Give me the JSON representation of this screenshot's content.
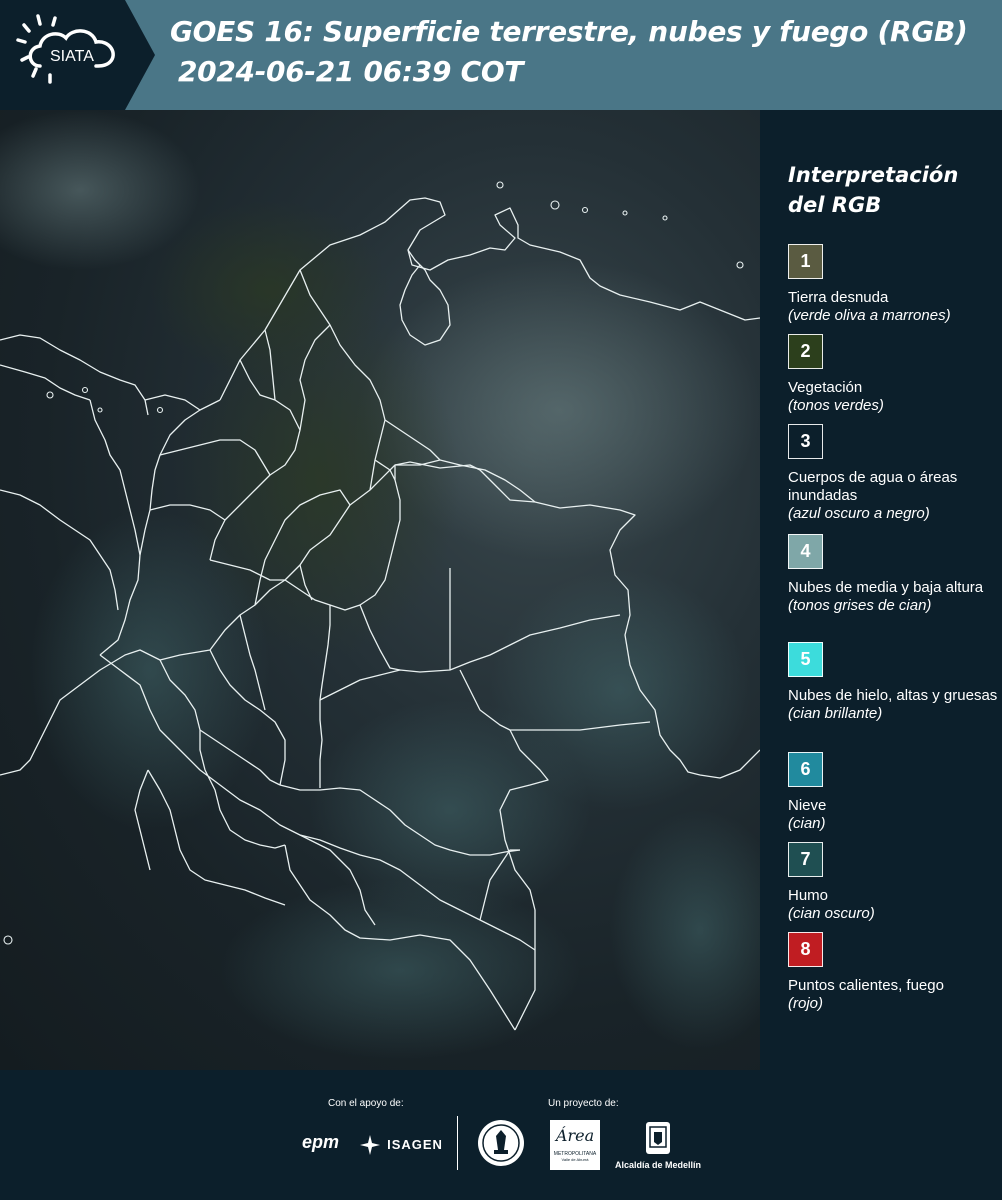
{
  "header": {
    "logo_text": "SIATA",
    "title_line1": "GOES 16: Superficie terrestre, nubes y fuego (RGB)",
    "title_line2": "2024-06-21 06:39 COT"
  },
  "legend": {
    "title_line1": "Interpretación",
    "title_line2": "del RGB",
    "items": [
      {
        "num": "1",
        "color": "#5a5b41",
        "name": "Tierra desnuda",
        "desc": "(verde oliva a marrones)"
      },
      {
        "num": "2",
        "color": "#2c3f1c",
        "name": "Vegetación",
        "desc": "(tonos verdes)"
      },
      {
        "num": "3",
        "color": "#0c1f2b",
        "name": "Cuerpos de agua o áreas inundadas",
        "desc": "(azul oscuro a negro)"
      },
      {
        "num": "4",
        "color": "#7fa7a8",
        "name": "Nubes de media y baja altura",
        "desc": "(tonos grises de cian)"
      },
      {
        "num": "5",
        "color": "#3cdcdc",
        "name": "Nubes de hielo, altas y gruesas",
        "desc": "(cian brillante)"
      },
      {
        "num": "6",
        "color": "#218a9e",
        "name": "Nieve",
        "desc": "(cian)"
      },
      {
        "num": "7",
        "color": "#1f4f52",
        "name": "Humo",
        "desc": "(cian oscuro)"
      },
      {
        "num": "8",
        "color": "#c01d22",
        "name": "Puntos calientes, fuego",
        "desc": "(rojo)"
      }
    ]
  },
  "footer": {
    "support_label": "Con el apoyo de:",
    "project_label": "Un proyecto de:",
    "epm_text": "epm",
    "isagen_text": "ISAGEN",
    "area_text": "Área",
    "area_sub1": "METROPOLITANA",
    "area_sub2": "Valle de Aburrá",
    "alcaldia_text": "Alcaldía de Medellín"
  }
}
